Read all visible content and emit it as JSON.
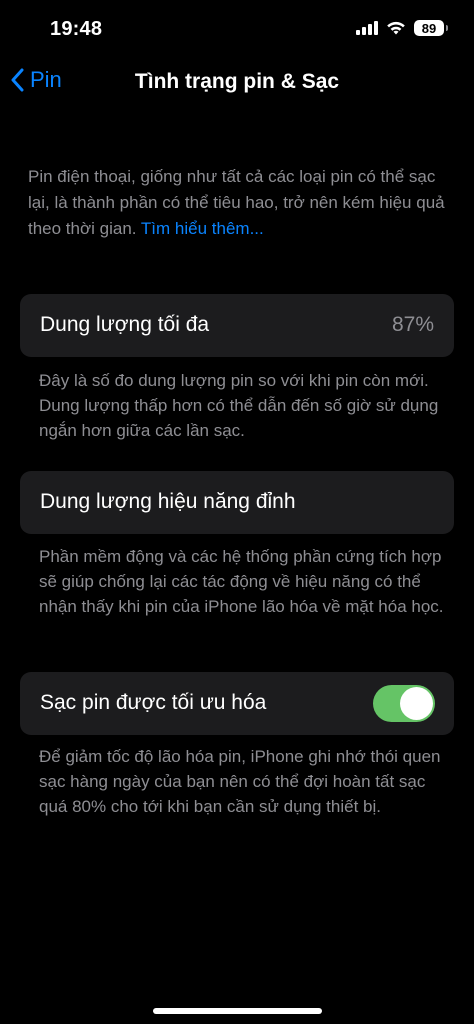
{
  "status_bar": {
    "time": "19:48",
    "battery_level": "89",
    "icons": [
      "signal-icon",
      "wifi-icon",
      "battery-icon"
    ]
  },
  "nav": {
    "back_label": "Pin",
    "title": "Tình trạng pin & Sạc",
    "back_icon": "chevron-left-icon"
  },
  "intro": {
    "text": "Pin điện thoại, giống như tất cả các loại pin có thể sạc lại, là thành phần có thể tiêu hao, trở nên kém hiệu quả theo thời gian. ",
    "link": "Tìm hiểu thêm..."
  },
  "max_capacity": {
    "label": "Dung lượng tối đa",
    "value": "87%",
    "footnote": "Đây là số đo dung lượng pin so với khi pin còn mới. Dung lượng thấp hơn có thể dẫn đến số giờ sử dụng ngắn hơn giữa các lần sạc."
  },
  "peak_performance": {
    "label": "Dung lượng hiệu năng đỉnh",
    "footnote": "Phần mềm động và các hệ thống phần cứng tích hợp sẽ giúp chống lại các tác động về hiệu năng có thể nhận thấy khi pin của iPhone lão hóa về mặt hóa học."
  },
  "optimized_charging": {
    "label": "Sạc pin được tối ưu hóa",
    "enabled": true,
    "footnote": "Để giảm tốc độ lão hóa pin, iPhone ghi nhớ thói quen sạc hàng ngày của bạn nên có thể đợi hoàn tất sạc quá 80% cho tới khi bạn cần sử dụng thiết bị."
  },
  "colors": {
    "background": "#000000",
    "card": "#1c1c1e",
    "accent": "#0a84ff",
    "toggle_on": "#65c466",
    "secondary_text": "#8e8e93"
  }
}
